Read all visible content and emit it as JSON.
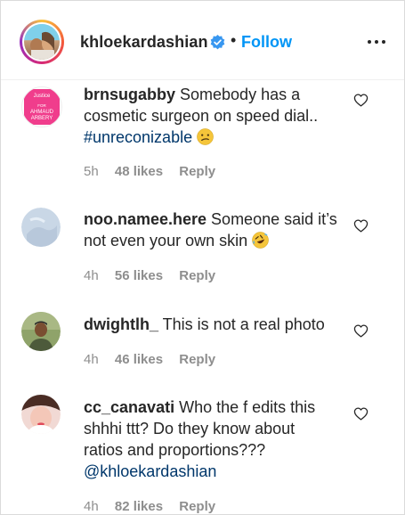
{
  "header": {
    "username": "khloekardashian",
    "separator": "•",
    "follow_label": "Follow"
  },
  "comments": [
    {
      "avatar_label_top": "Justice",
      "avatar_label_mid": "FOR",
      "avatar_label_bottom": "AHMAUD",
      "avatar_label_last": "ARBERY",
      "username": "brnsugabby",
      "text_before": " Somebody has a cosmetic surgeon on speed dial.. ",
      "hashtag": "#unreconizable",
      "emoji": "confused-face",
      "time": "5h",
      "likes": "48 likes",
      "reply": "Reply"
    },
    {
      "username": "noo.namee.here",
      "text_before": " Someone said it’s not even your own skin ",
      "emoji": "rolling-laughing-face",
      "time": "4h",
      "likes": "56 likes",
      "reply": "Reply"
    },
    {
      "username": "dwightlh_",
      "text_before": " This is not a real photo",
      "time": "4h",
      "likes": "46 likes",
      "reply": "Reply"
    },
    {
      "username": "cc_canavati",
      "text_before": " Who the f edits this shhhi ttt? Do they know about ratios and proportions??? ",
      "mention": "@khloekardashian",
      "time": "4h",
      "likes": "82 likes",
      "reply": "Reply"
    }
  ],
  "colors": {
    "follow": "#0095f6",
    "link": "#00376b",
    "meta": "#8e8e8e",
    "verified": "#3897f0"
  }
}
